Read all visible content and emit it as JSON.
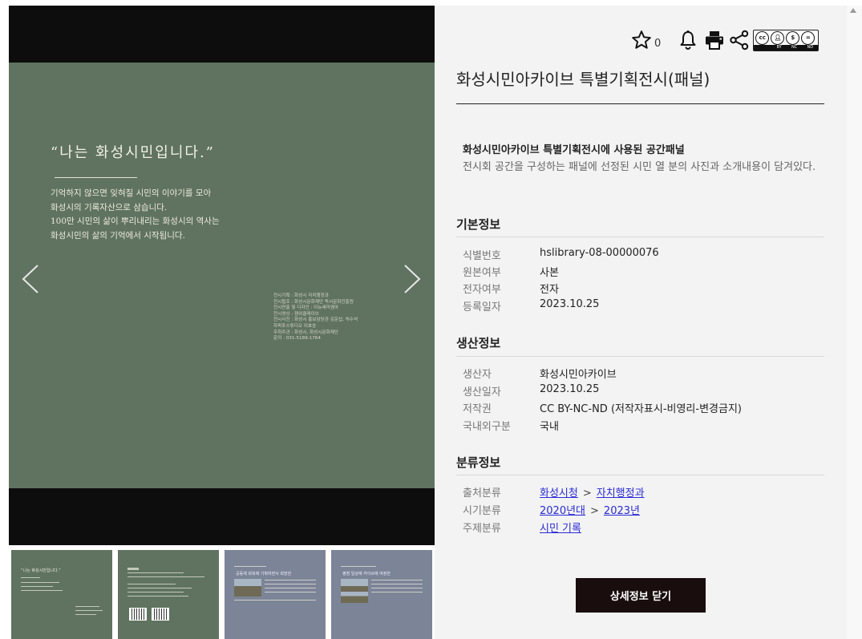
{
  "viewer": {
    "quote": "“나는 화성시민입니다.”",
    "body_lines": [
      "기억하지 않으면 잊혀질 시민의 이야기를 모아",
      "화성시의 기록자산으로 삼습니다.",
      "100만 시민의 삶이 뿌리내리는 화성시의 역사는",
      "화성시민의 삶의 기억에서 시작됩니다."
    ],
    "credits": [
      "전시기획 : 화성시 자치행정과",
      "전시협조 : 화성시문화재단 독서문화진흥원",
      "전시연출 및 디자인 : 이뉴세미엠아",
      "전시영상 : 잼위클레이브",
      "전시사진 : 화성시 홍보담당관 김운섭, 허수석",
      "하퍼포스튜디오 이효승",
      "주최주관 : 화성시, 화성시문화재단",
      "문의 : 031-5189-1764"
    ],
    "thumb1_title": "“나는 화성시민입니다.”",
    "thumb3_head": "공동체 회복에 기획하면서 희망한",
    "thumb4_head": "평범 일상에 카이브에 여정한"
  },
  "toolbar": {
    "star_count": "0"
  },
  "cc": {
    "labels": [
      "BY",
      "NC",
      "ND"
    ]
  },
  "record": {
    "title": "화성시민아카이브 특별기획전시(패널)",
    "summary_title": "화성시민아카이브 특별기획전시에 사용된 공간패널",
    "summary_desc": "전시회 공간을 구성하는 패널에 선정된 시민 열 분의 사진과 소개내용이 담겨있다."
  },
  "basic": {
    "heading": "기본정보",
    "rows": [
      {
        "k": "식별번호",
        "v": "hslibrary-08-00000076"
      },
      {
        "k": "원본여부",
        "v": "사본"
      },
      {
        "k": "전자여부",
        "v": "전자"
      },
      {
        "k": "등록일자",
        "v": "2023.10.25"
      }
    ]
  },
  "production": {
    "heading": "생산정보",
    "rows": [
      {
        "k": "생산자",
        "v": "화성시민아카이브"
      },
      {
        "k": "생산일자",
        "v": "2023.10.25"
      },
      {
        "k": "저작권",
        "v": "CC BY-NC-ND (저작자표시-비영리-변경금지)"
      },
      {
        "k": "국내외구분",
        "v": "국내"
      }
    ]
  },
  "classification": {
    "heading": "분류정보",
    "source_label": "출처분류",
    "source_a": "화성시청",
    "source_b": "자치행정과",
    "period_label": "시기분류",
    "period_a": "2020년대",
    "period_b": "2023년",
    "subject_label": "주제분류",
    "subject_a": "시민 기록",
    "sep": ">"
  },
  "close_button": "상세정보 닫기",
  "icons": [
    "star-icon",
    "bell-icon",
    "print-icon",
    "share-icon",
    "cc-license-icon",
    "chevron-left-icon",
    "chevron-right-icon"
  ]
}
